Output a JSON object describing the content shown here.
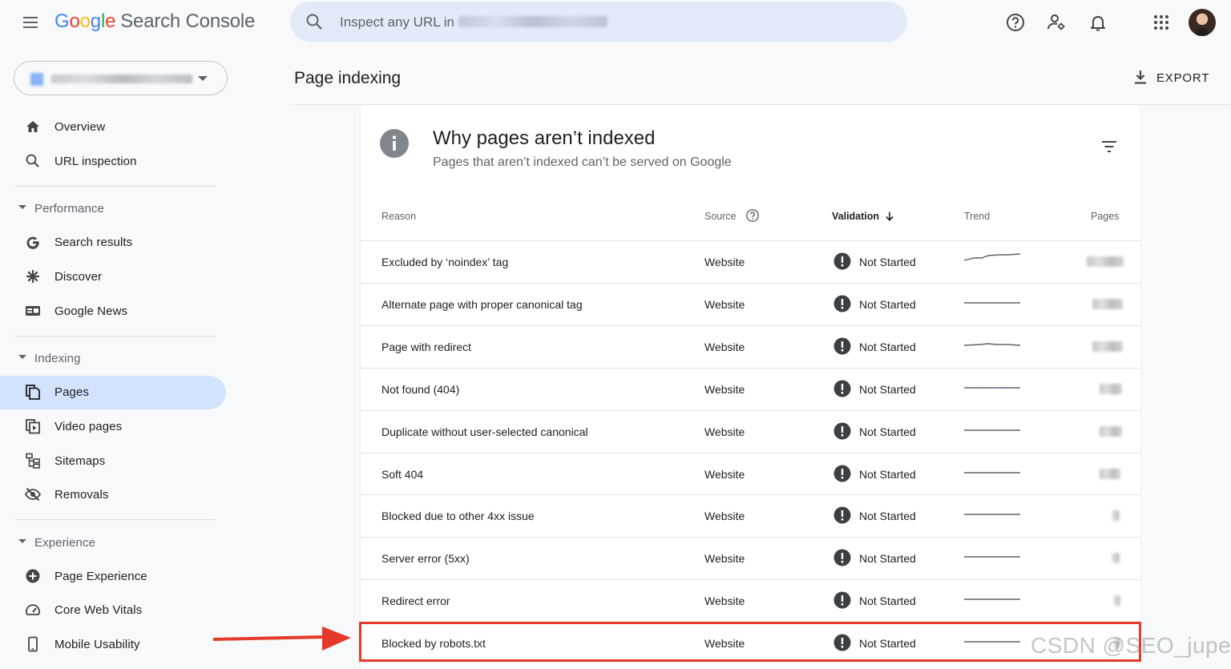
{
  "app": {
    "logo_letters": [
      "G",
      "o",
      "o",
      "g",
      "l",
      "e"
    ],
    "product_name": "Search Console"
  },
  "search": {
    "placeholder": "Inspect any URL in"
  },
  "sidebar": {
    "top_items": [
      {
        "label": "Overview",
        "icon": "home-icon"
      },
      {
        "label": "URL inspection",
        "icon": "search-icon"
      }
    ],
    "sections": [
      {
        "title": "Performance",
        "items": [
          {
            "label": "Search results",
            "icon": "google-g-icon"
          },
          {
            "label": "Discover",
            "icon": "asterisk-icon"
          },
          {
            "label": "Google News",
            "icon": "news-icon"
          }
        ]
      },
      {
        "title": "Indexing",
        "items": [
          {
            "label": "Pages",
            "icon": "pages-icon",
            "active": true
          },
          {
            "label": "Video pages",
            "icon": "video-pages-icon"
          },
          {
            "label": "Sitemaps",
            "icon": "sitemap-icon"
          },
          {
            "label": "Removals",
            "icon": "eye-off-icon"
          }
        ]
      },
      {
        "title": "Experience",
        "items": [
          {
            "label": "Page Experience",
            "icon": "plus-circle-icon"
          },
          {
            "label": "Core Web Vitals",
            "icon": "speedometer-icon"
          },
          {
            "label": "Mobile Usability",
            "icon": "phone-icon"
          }
        ]
      }
    ]
  },
  "header": {
    "title": "Page indexing",
    "export_label": "EXPORT"
  },
  "card": {
    "title": "Why pages aren’t indexed",
    "subtitle": "Pages that aren’t indexed can’t be served on Google",
    "columns": {
      "reason": "Reason",
      "source": "Source",
      "validation": "Validation",
      "trend": "Trend",
      "pages": "Pages"
    },
    "rows": [
      {
        "reason": "Excluded by ‘noindex’ tag",
        "source": "Website",
        "validation": "Not Started"
      },
      {
        "reason": "Alternate page with proper canonical tag",
        "source": "Website",
        "validation": "Not Started"
      },
      {
        "reason": "Page with redirect",
        "source": "Website",
        "validation": "Not Started"
      },
      {
        "reason": "Not found (404)",
        "source": "Website",
        "validation": "Not Started"
      },
      {
        "reason": "Duplicate without user-selected canonical",
        "source": "Website",
        "validation": "Not Started"
      },
      {
        "reason": "Soft 404",
        "source": "Website",
        "validation": "Not Started"
      },
      {
        "reason": "Blocked due to other 4xx issue",
        "source": "Website",
        "validation": "Not Started"
      },
      {
        "reason": "Server error (5xx)",
        "source": "Website",
        "validation": "Not Started"
      },
      {
        "reason": "Redirect error",
        "source": "Website",
        "validation": "Not Started"
      },
      {
        "reason": "Blocked by robots.txt",
        "source": "Website",
        "validation": "Not Started"
      }
    ]
  },
  "annotation": {
    "watermark": "CSDN @SEO_juper",
    "color": "#e53a2b"
  },
  "colors": {
    "active_nav": "#d3e3fd",
    "search_bg": "#e3eaf8",
    "status_icon": "#3c4043"
  }
}
